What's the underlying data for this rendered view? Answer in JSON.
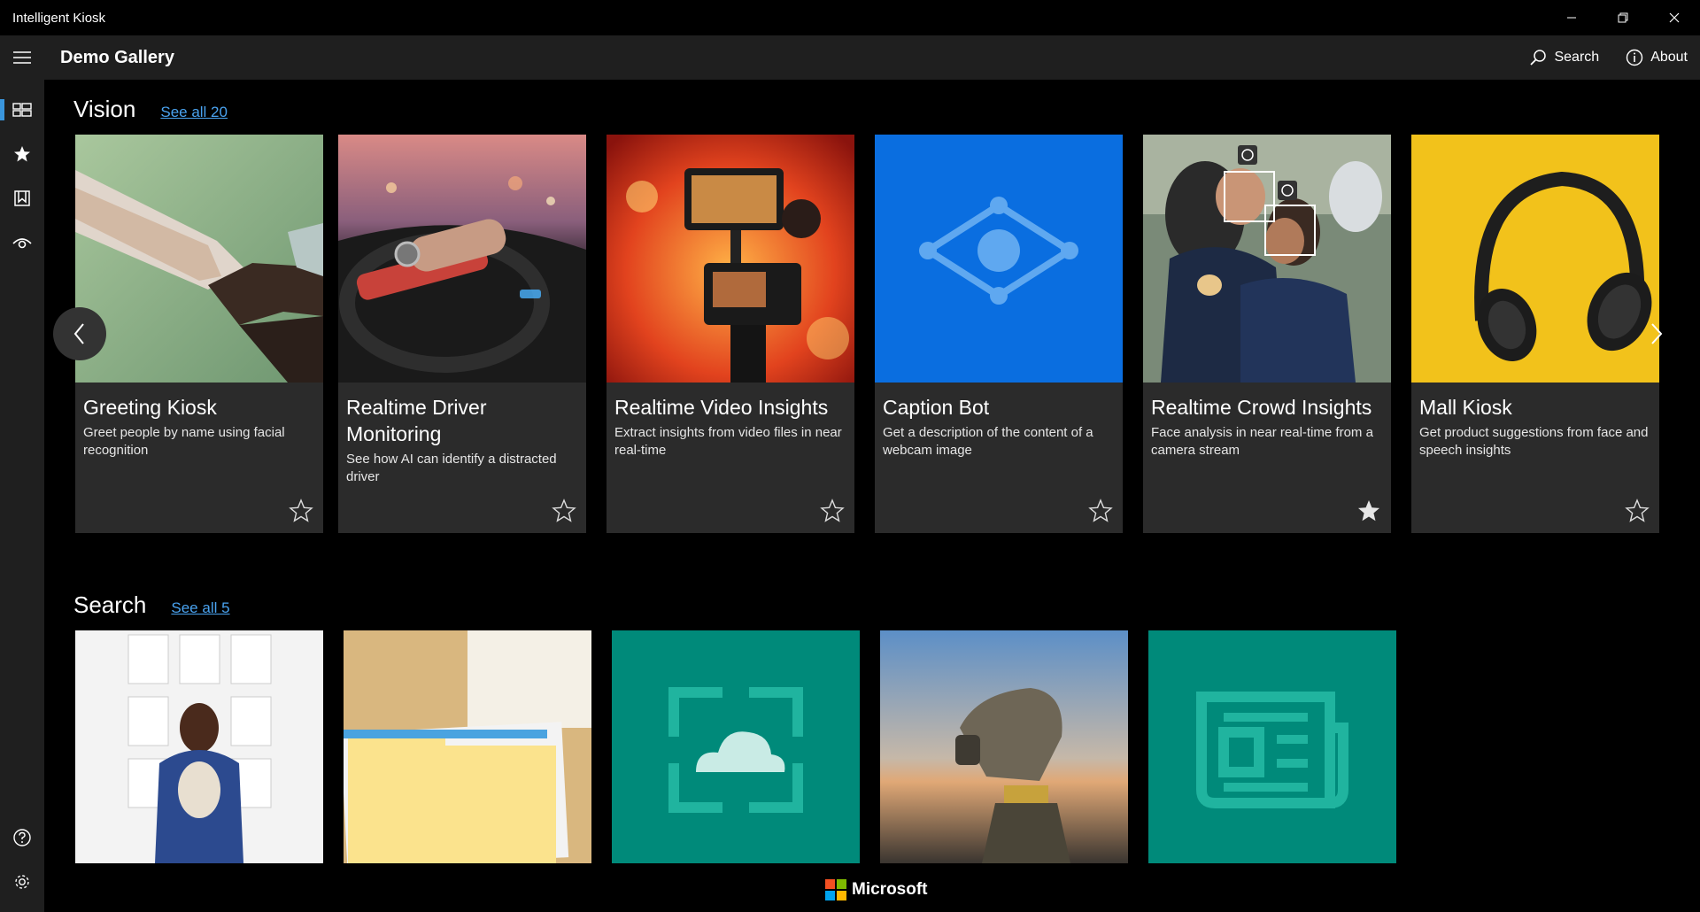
{
  "window": {
    "title": "Intelligent Kiosk"
  },
  "header": {
    "title": "Demo Gallery",
    "search_label": "Search",
    "about_label": "About"
  },
  "sections": [
    {
      "title": "Vision",
      "see_all": "See all 20",
      "cards": [
        {
          "title": "Greeting Kiosk",
          "description": "Greet people by name using facial recognition",
          "favorite": false
        },
        {
          "title": "Realtime Driver Monitoring",
          "description": "See how AI can identify a distracted driver",
          "favorite": false
        },
        {
          "title": "Realtime Video Insights",
          "description": "Extract insights from video files in near real-time",
          "favorite": false
        },
        {
          "title": "Caption Bot",
          "description": "Get a description of the content of a webcam image",
          "favorite": false
        },
        {
          "title": "Realtime Crowd Insights",
          "description": "Face analysis in near real-time from a camera stream",
          "favorite": true
        },
        {
          "title": "Mall Kiosk",
          "description": "Get product suggestions from face and speech insights",
          "favorite": false
        }
      ]
    },
    {
      "title": "Search",
      "see_all": "See all 5"
    }
  ],
  "footer": {
    "brand": "Microsoft"
  },
  "colors": {
    "accent": "#3a96dd",
    "link": "#4aa3f0",
    "caption_bot_tile": "#0a6ee0",
    "search_teal": "#008a7a",
    "mall_yellow": "#f2c21b"
  }
}
